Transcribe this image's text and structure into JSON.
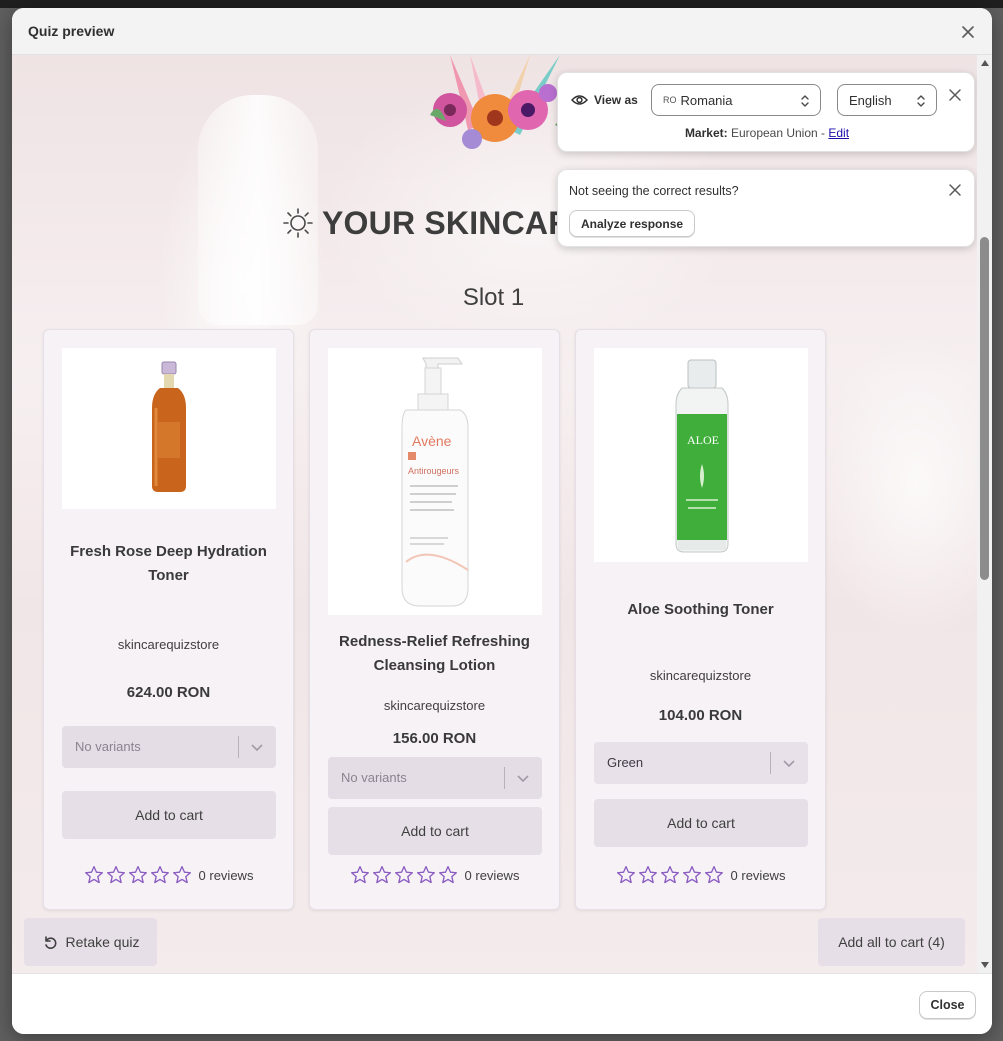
{
  "modal": {
    "title": "Quiz preview",
    "close_icon": "close-icon",
    "footer_close_label": "Close"
  },
  "quiz": {
    "heading": "YOUR SKINCARE",
    "heading_icon": "sun-icon",
    "slot_title": "Slot 1",
    "star_color": "#8a5cc0",
    "products": [
      {
        "name": "Fresh Rose Deep Hydration Toner",
        "vendor": "skincarequizstore",
        "price": "624.00 RON",
        "variant": "No variants",
        "variant_disabled": true,
        "add_label": "Add to cart",
        "reviews": "0 reviews",
        "image_icon": "amber-toner-bottle-icon"
      },
      {
        "name": "Redness-Relief Refreshing Cleansing Lotion",
        "vendor": "skincarequizstore",
        "price": "156.00 RON",
        "variant": "No variants",
        "variant_disabled": true,
        "add_label": "Add to cart",
        "reviews": "0 reviews",
        "image_icon": "pump-lotion-bottle-icon",
        "bottle_lines": [
          "Avène",
          "Antirougeurs"
        ]
      },
      {
        "name": "Aloe Soothing Toner",
        "vendor": "skincarequizstore",
        "price": "104.00 RON",
        "variant": "Green",
        "variant_disabled": false,
        "add_label": "Add to cart",
        "reviews": "0 reviews",
        "image_icon": "green-toner-bottle-icon",
        "bottle_lines": [
          "ALOE"
        ]
      }
    ],
    "retake_label": "Retake quiz",
    "add_all_label": "Add all to cart (4)"
  },
  "view_as": {
    "label": "View as",
    "country_code": "RO",
    "country": "Romania",
    "language": "English",
    "market_label": "Market:",
    "market_value": "European Union -",
    "market_edit": "Edit"
  },
  "issue": {
    "text": "Not seeing the correct results?",
    "button": "Analyze response"
  }
}
